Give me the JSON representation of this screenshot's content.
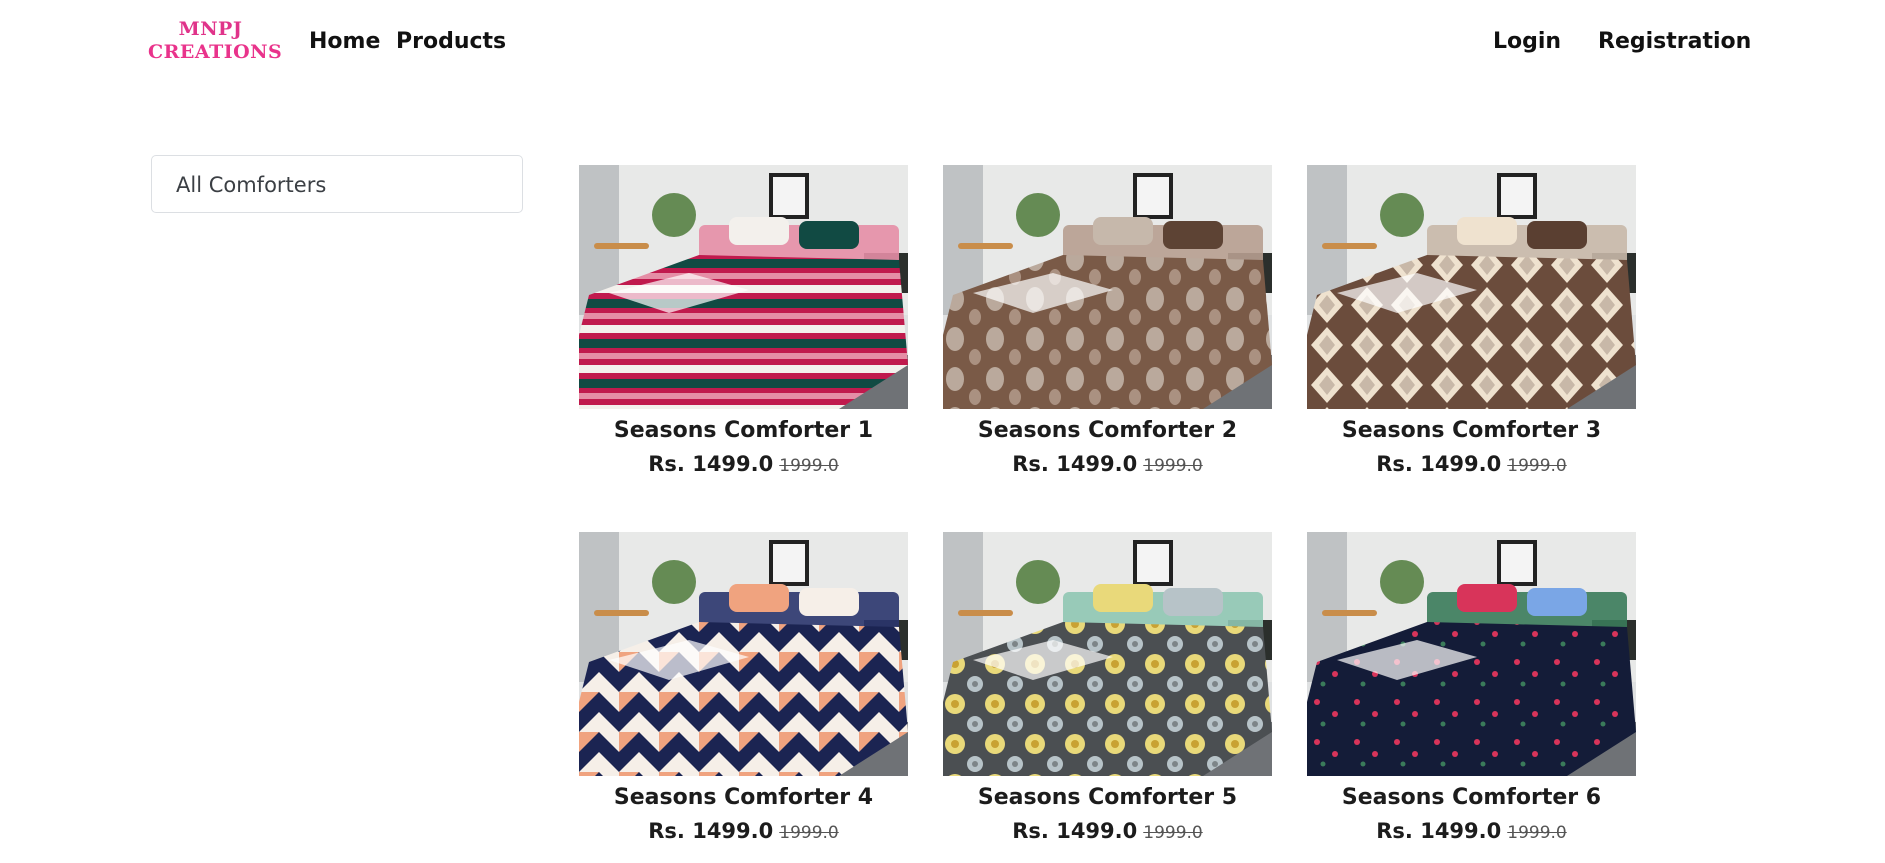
{
  "brand": {
    "line1": "MNPJ",
    "line2": "CREATIONS"
  },
  "nav": {
    "home": "Home",
    "products": "Products",
    "login": "Login",
    "registration": "Registration"
  },
  "sidebar": {
    "category": "All Comforters"
  },
  "products": [
    {
      "name": "Seasons Comforter 1",
      "price": "Rs. 1499.0",
      "old_price": "1999.0",
      "pattern": "stripes",
      "colors": [
        "#c01a4d",
        "#f3f0ec",
        "#114a43",
        "#e58ea6"
      ]
    },
    {
      "name": "Seasons Comforter 2",
      "price": "Rs. 1499.0",
      "old_price": "1999.0",
      "pattern": "leaves",
      "colors": [
        "#7a5a47",
        "#c6b8ab",
        "#5d4334",
        "#b79f90"
      ]
    },
    {
      "name": "Seasons Comforter 3",
      "price": "Rs. 1499.0",
      "old_price": "1999.0",
      "pattern": "diamonds",
      "colors": [
        "#6b4c3c",
        "#efe2cf",
        "#5a3f31",
        "#c8b8a8"
      ]
    },
    {
      "name": "Seasons Comforter 4",
      "price": "Rs. 1499.0",
      "old_price": "1999.0",
      "pattern": "triangles",
      "colors": [
        "#1b2452",
        "#f0a37f",
        "#f6efe8",
        "#2a356d"
      ]
    },
    {
      "name": "Seasons Comforter 5",
      "price": "Rs. 1499.0",
      "old_price": "1999.0",
      "pattern": "flowers",
      "colors": [
        "#4b4f52",
        "#e9d97a",
        "#b7c3c8",
        "#8fc7b2"
      ]
    },
    {
      "name": "Seasons Comforter 6",
      "price": "Rs. 1499.0",
      "old_price": "1999.0",
      "pattern": "hearts",
      "colors": [
        "#141c38",
        "#d8345a",
        "#7aa6e6",
        "#3a7b5a"
      ]
    }
  ]
}
